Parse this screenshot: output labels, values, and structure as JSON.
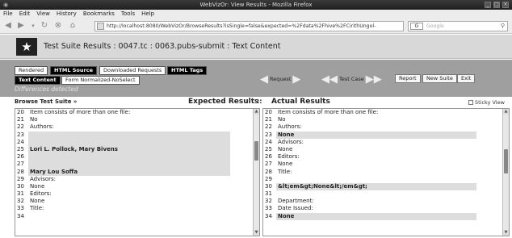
{
  "window": {
    "title": "WebVizOr: View Results - Mozilla Firefox"
  },
  "menu": [
    "File",
    "Edit",
    "View",
    "History",
    "Bookmarks",
    "Tools",
    "Help"
  ],
  "nav": {
    "url": "http://localhost:8080/WebVizOr/BrowseResults?isSingle=false&expected=%2Fdata%2Fhive%2FCirithUngol-",
    "search_placeholder": "Google",
    "search_engine": "G"
  },
  "header": {
    "title": "Test Suite Results :  0047.tc  :  0063.pubs-submit  :  Text Content"
  },
  "tabs": {
    "rendered": "Rendered",
    "html_source": "HTML Source",
    "downloaded": "Downloaded Requests",
    "html_tags": "HTML Tags",
    "text_content": "Text Content",
    "form_normalized": "Form Normalized-NoSelect"
  },
  "status": {
    "differences": "Differences detected"
  },
  "controls": {
    "request": "Request",
    "test_case": "Test Case",
    "report": "Report",
    "new_suite": "New Suite",
    "exit": "Exit"
  },
  "labels": {
    "browse": "Browse Test Suite »",
    "expected": "Expected Results",
    "separator": "::",
    "actual": "Actual Results",
    "sticky": "Sticky View"
  },
  "expected_rows": [
    {
      "n": "20",
      "t": "Item consists of more than one file:",
      "hl": false
    },
    {
      "n": "21",
      "t": "No",
      "hl": false
    },
    {
      "n": "22",
      "t": "Authors:",
      "hl": false
    },
    {
      "n": "23",
      "t": "",
      "hl": true
    },
    {
      "n": "24",
      "t": "",
      "hl": true
    },
    {
      "n": "25",
      "t": "Lori L. Pollock, Mary Bivens",
      "hl": true
    },
    {
      "n": "26",
      "t": "",
      "hl": true
    },
    {
      "n": "27",
      "t": "",
      "hl": true
    },
    {
      "n": "28",
      "t": "Mary Lou Soffa",
      "hl": true
    },
    {
      "n": "29",
      "t": "Advisors:",
      "hl": false
    },
    {
      "n": "30",
      "t": "None",
      "hl": false
    },
    {
      "n": "31",
      "t": "Editors:",
      "hl": false
    },
    {
      "n": "32",
      "t": "None",
      "hl": false
    },
    {
      "n": "33",
      "t": "Title:",
      "hl": false
    },
    {
      "n": "34",
      "t": "",
      "hl": false
    }
  ],
  "actual_rows": [
    {
      "n": "20",
      "t": "Item consists of more than one file:",
      "hl": false
    },
    {
      "n": "21",
      "t": "No",
      "hl": false
    },
    {
      "n": "22",
      "t": "Authors:",
      "hl": false
    },
    {
      "n": "23",
      "t": "None",
      "hl": true
    },
    {
      "n": "24",
      "t": "Advisors:",
      "hl": false
    },
    {
      "n": "25",
      "t": "None",
      "hl": false
    },
    {
      "n": "26",
      "t": "Editors:",
      "hl": false
    },
    {
      "n": "27",
      "t": "None",
      "hl": false
    },
    {
      "n": "28",
      "t": "Title:",
      "hl": false
    },
    {
      "n": "29",
      "t": "",
      "hl": false
    },
    {
      "n": "30",
      "t": "&lt;em&gt;None&lt;/em&gt;",
      "hl": true
    },
    {
      "n": "31",
      "t": "",
      "hl": false
    },
    {
      "n": "32",
      "t": "Department:",
      "hl": false
    },
    {
      "n": "33",
      "t": "Date Issued:",
      "hl": false
    },
    {
      "n": "34",
      "t": "None",
      "hl": true
    }
  ]
}
